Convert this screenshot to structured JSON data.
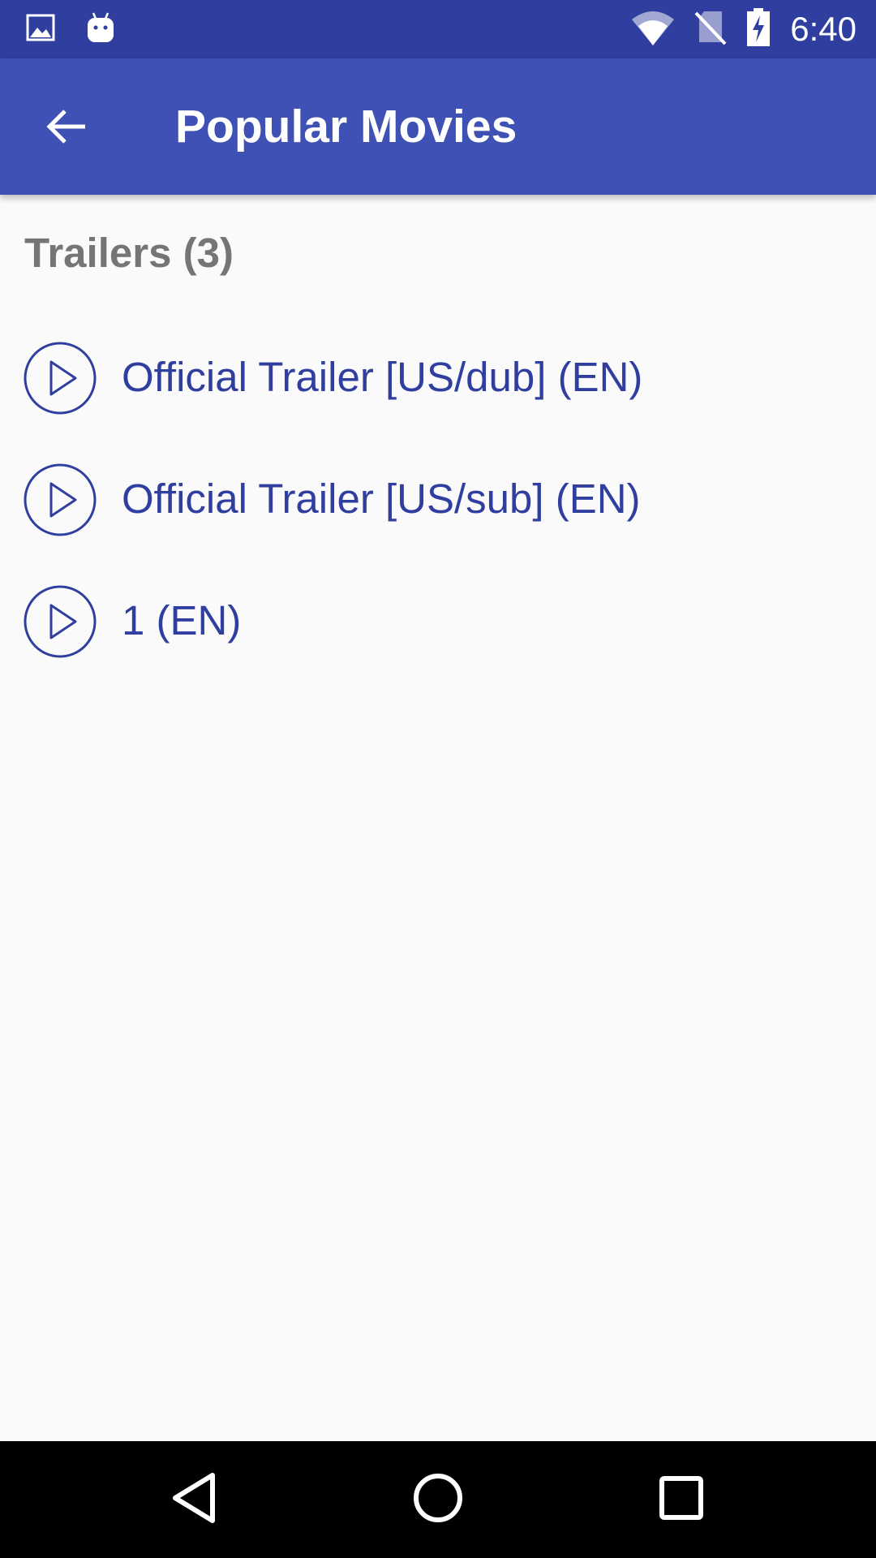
{
  "status_bar": {
    "time": "6:40",
    "left_icons": [
      "image-icon",
      "android-icon"
    ],
    "right_icons": [
      "wifi-icon",
      "no-sim-icon",
      "battery-charging-icon"
    ]
  },
  "app_bar": {
    "title": "Popular Movies",
    "back_icon": "arrow-back-icon"
  },
  "trailers": {
    "section_title": "Trailers (3)",
    "items": [
      {
        "label": "Official Trailer [US/dub] (EN)",
        "icon": "play-circle-icon"
      },
      {
        "label": "Official Trailer [US/sub] (EN)",
        "icon": "play-circle-icon"
      },
      {
        "label": "1 (EN)",
        "icon": "play-circle-icon"
      }
    ]
  },
  "nav_bar": {
    "buttons": [
      "back-triangle-icon",
      "home-circle-icon",
      "recents-square-icon"
    ]
  },
  "colors": {
    "status_bar": "#303f9f",
    "app_bar": "#3f51b5",
    "accent_text": "#303f9f",
    "section_title": "#757575",
    "background": "#fafafa",
    "nav_bar": "#000000"
  }
}
